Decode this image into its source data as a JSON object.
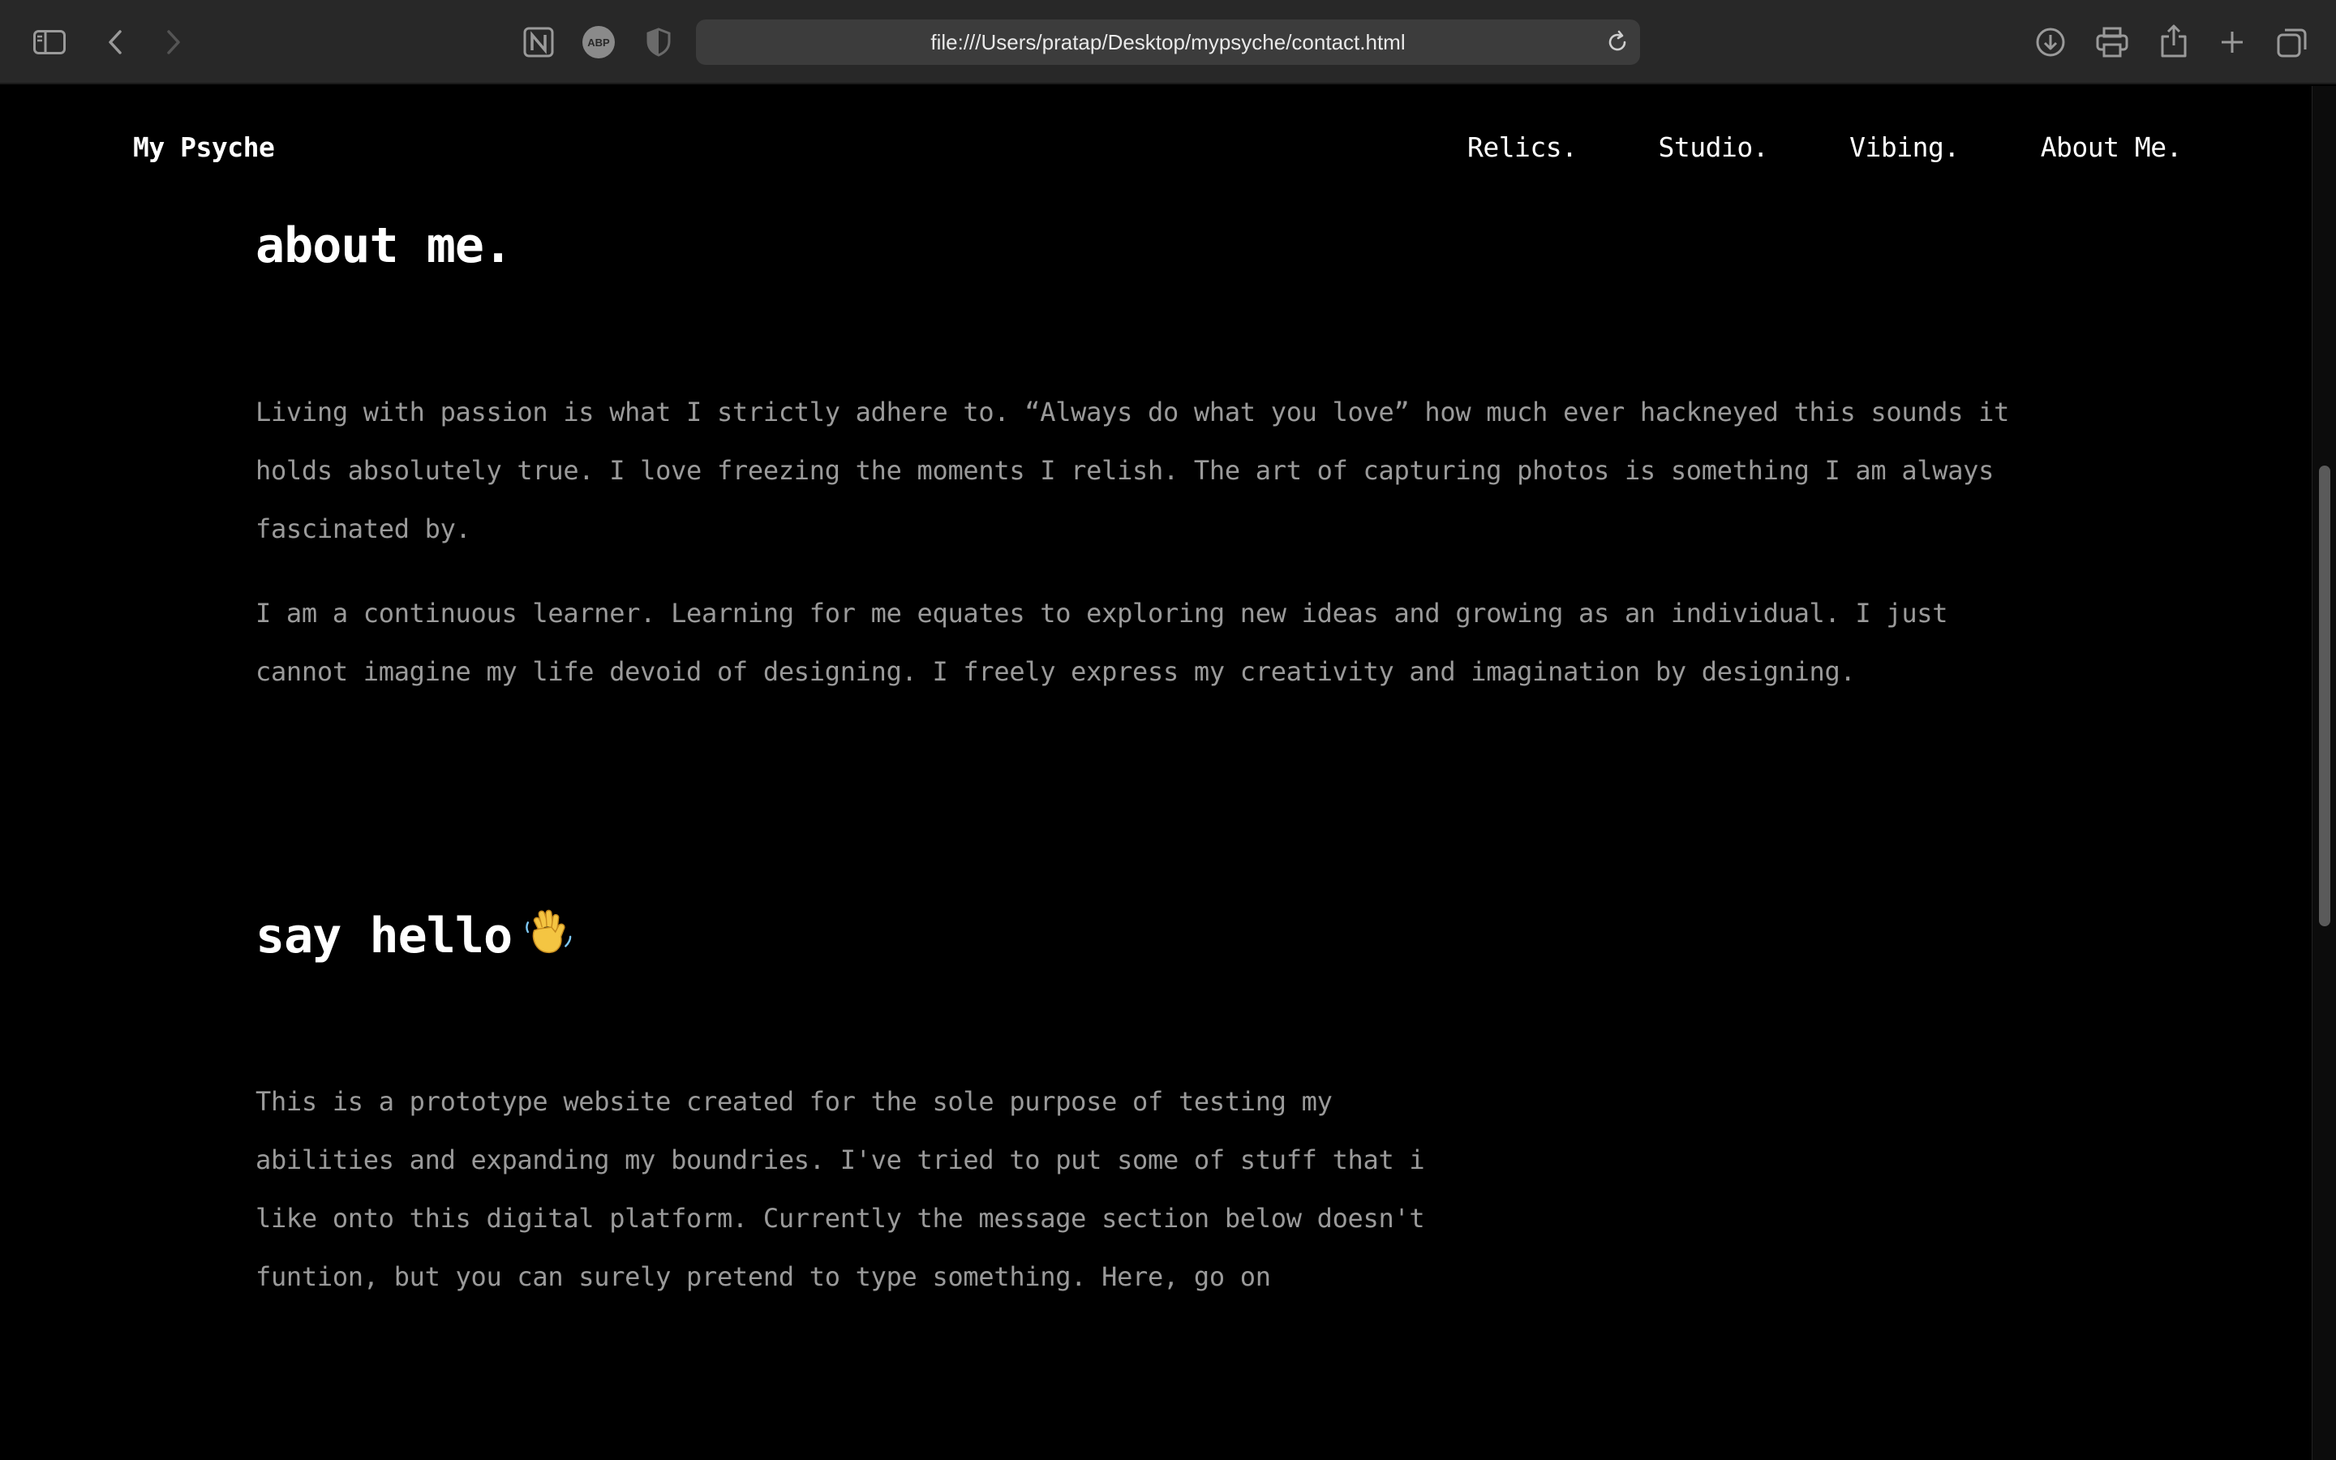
{
  "browser": {
    "url": "file:///Users/pratap/Desktop/mypsyche/contact.html",
    "icons": {
      "sidebar": "sidebar-icon",
      "back": "chevron-left-icon",
      "forward": "chevron-right-icon",
      "notion": "notion-icon",
      "adblock": "adblock-icon",
      "adblock_label": "ABP",
      "privacy": "shield-icon",
      "reload": "reload-icon",
      "downloads": "download-icon",
      "print": "print-icon",
      "share": "share-icon",
      "new_tab": "plus-icon",
      "tabs": "tabs-overview-icon"
    }
  },
  "site": {
    "logo": "My Psyche",
    "nav": [
      {
        "label": "Relics."
      },
      {
        "label": "Studio."
      },
      {
        "label": "Vibing."
      },
      {
        "label": "About Me."
      }
    ]
  },
  "about": {
    "heading": "about me.",
    "paragraphs": [
      {
        "lines": [
          "Living with passion is what I strictly adhere to. “Always do what you love” how much ever hackneyed this sounds it",
          "holds absolutely true. I love freezing the moments I relish. The art of capturing photos is something I am always",
          "fascinated by."
        ]
      },
      {
        "lines": [
          "I am a continuous learner. Learning for me equates to exploring new ideas and growing as an individual. I just",
          "cannot imagine my life devoid of designing. I freely express my creativity and imagination by designing."
        ]
      }
    ]
  },
  "hello": {
    "heading": "say hello",
    "icon": "waving-hand-icon",
    "lines": [
      "This is a prototype website created for the sole purpose of testing my",
      "abilities and expanding my boundries. I've tried to put some of stuff that i",
      "like onto this digital platform. Currently the message section below doesn't",
      "funtion, but you can surely pretend to type something. Here, go on"
    ]
  },
  "colors": {
    "page_bg": "#000000",
    "toolbar_bg": "#282828",
    "heading": "#ffffff",
    "body_text": "#9a9a9a"
  }
}
